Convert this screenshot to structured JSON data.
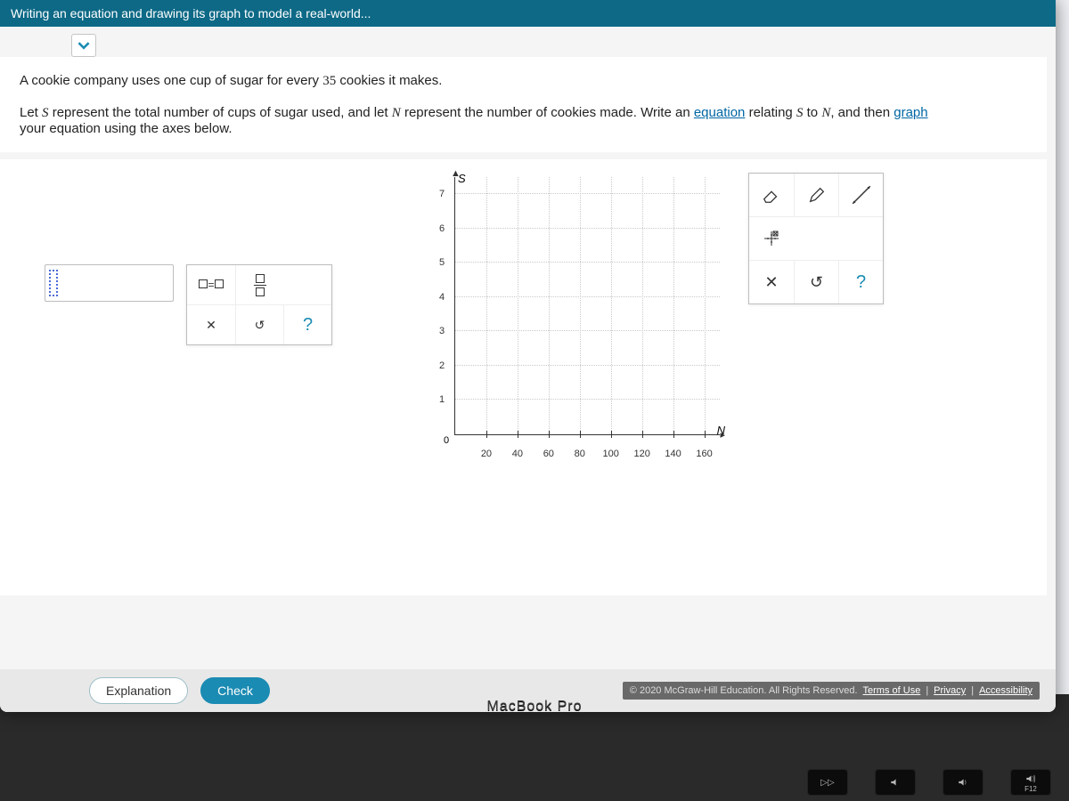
{
  "header": {
    "title": "Writing an equation and drawing its graph to model a real-world..."
  },
  "problem": {
    "line1_pre": "A cookie company uses one cup of sugar for every ",
    "count": "35",
    "line1_post": " cookies it makes.",
    "line2_a": "Let ",
    "S": "S",
    "line2_b": " represent the total number of cups of sugar used, and let ",
    "N": "N",
    "line2_c": " represent the number of cookies made. Write an ",
    "link1": "equation",
    "line2_d": " relating ",
    "line2_e": " to ",
    "line2_f": ", and then ",
    "link2": "graph",
    "line2_g": " your equation using the axes below."
  },
  "eq_tools": {
    "eq": "☐=☐",
    "clear": "✕",
    "reset": "↺",
    "help": "?"
  },
  "graph_tools": {
    "eraser": "eraser",
    "pencil": "pencil",
    "line": "line",
    "point_cross": "point-cross",
    "clear": "✕",
    "reset": "↺",
    "help": "?"
  },
  "chart_data": {
    "type": "scatter",
    "title": "",
    "xlabel": "N",
    "ylabel": "S",
    "x_ticks": [
      20,
      40,
      60,
      80,
      100,
      120,
      140,
      160
    ],
    "y_ticks": [
      1,
      2,
      3,
      4,
      5,
      6,
      7
    ],
    "xlim": [
      0,
      170
    ],
    "ylim": [
      0,
      7.5
    ],
    "series": []
  },
  "footer": {
    "explanation": "Explanation",
    "check": "Check",
    "copyright": "© 2020 McGraw-Hill Education. All Rights Reserved.",
    "terms": "Terms of Use",
    "privacy": "Privacy",
    "accessibility": "Accessibility"
  },
  "device": {
    "hinge": "MacBook Pro",
    "key_f12": "F12"
  }
}
